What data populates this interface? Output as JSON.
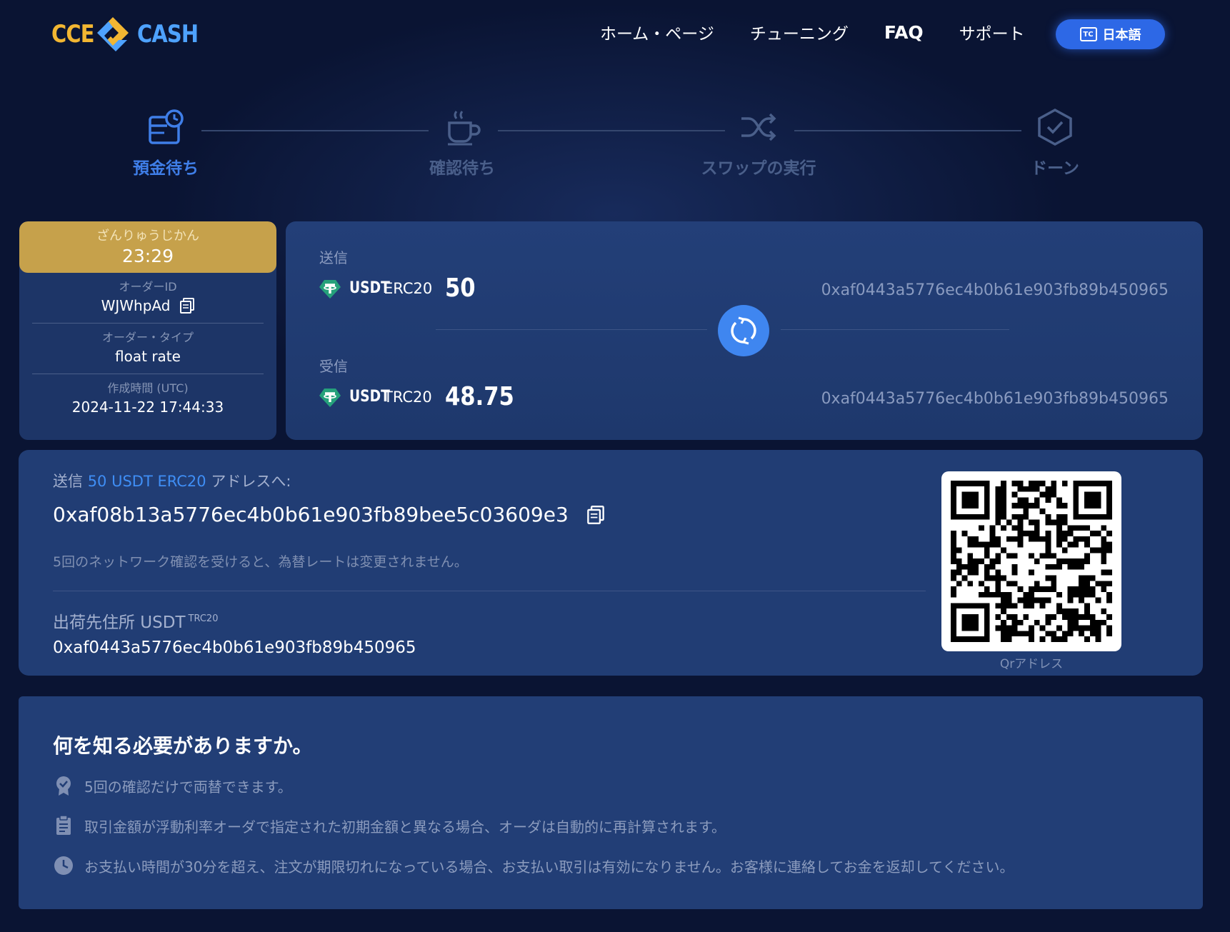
{
  "brand": {
    "left": "CCE",
    "right": "CASH"
  },
  "nav": {
    "items": [
      {
        "label": "ホーム・ページ"
      },
      {
        "label": "チューニング"
      },
      {
        "label": "FAQ"
      },
      {
        "label": "サポート"
      }
    ],
    "language": {
      "icon_text": "TC",
      "label": "日本語"
    }
  },
  "steps": [
    {
      "label": "預金待ち",
      "icon": "wallet-clock-icon",
      "active": true
    },
    {
      "label": "確認待ち",
      "icon": "coffee-cup-icon",
      "active": false
    },
    {
      "label": "スワップの実行",
      "icon": "shuffle-icon",
      "active": false
    },
    {
      "label": "ドーン",
      "icon": "shield-check-icon",
      "active": false
    }
  ],
  "order": {
    "timer_label": "ざんりゅうじかん",
    "timer_value": "23:29",
    "id_label": "オーダーID",
    "id_value": "WJWhpAd",
    "type_label": "オーダー・タイプ",
    "type_value": "float rate",
    "created_label": "作成時間 (UTC)",
    "created_value": "2024-11-22 17:44:33"
  },
  "swap": {
    "send_label": "送信",
    "send": {
      "coin": "USDT",
      "network": "ERC20",
      "amount": "50",
      "address": "0xaf0443a5776ec4b0b61e903fb89b450965"
    },
    "receive_label": "受信",
    "receive": {
      "coin": "USDT",
      "network": "TRC20",
      "amount": "48.75",
      "address": "0xaf0443a5776ec4b0b61e903fb89b450965"
    }
  },
  "deposit": {
    "title_prefix": "送信",
    "title_highlight": "50 USDT ERC20",
    "title_suffix": "アドレスへ:",
    "address": "0xaf08b13a5776ec4b0b61e903fb89bee5c03609e3",
    "note": "5回のネットワーク確認を受けると、為替レートは変更されません。",
    "recipient_label": "出荷先住所 USDT",
    "recipient_network": "TRC20",
    "recipient_address": "0xaf0443a5776ec4b0b61e903fb89b450965",
    "qr_label": "Qrアドレス"
  },
  "info": {
    "title": "何を知る必要がありますか。",
    "items": [
      {
        "icon": "badge-check-icon",
        "text": "5回の確認だけで両替できます。"
      },
      {
        "icon": "clipboard-icon",
        "text": "取引金額が浮動利率オーダで指定された初期金額と異なる場合、オーダは自動的に再計算されます。"
      },
      {
        "icon": "clock-icon",
        "text": "お支払い時間が30分を超え、注文が期限切れになっている場合、お支払い取引は有効になりません。お客様に連絡してお金を返却してください。"
      }
    ]
  },
  "colors": {
    "background": "#0a1433",
    "card": "#213d74",
    "accent": "#3f86f0",
    "timer": "#c6a14b",
    "brand_gold": "#f2b632",
    "brand_blue": "#4ea2ff",
    "tether": "#26a17b"
  }
}
